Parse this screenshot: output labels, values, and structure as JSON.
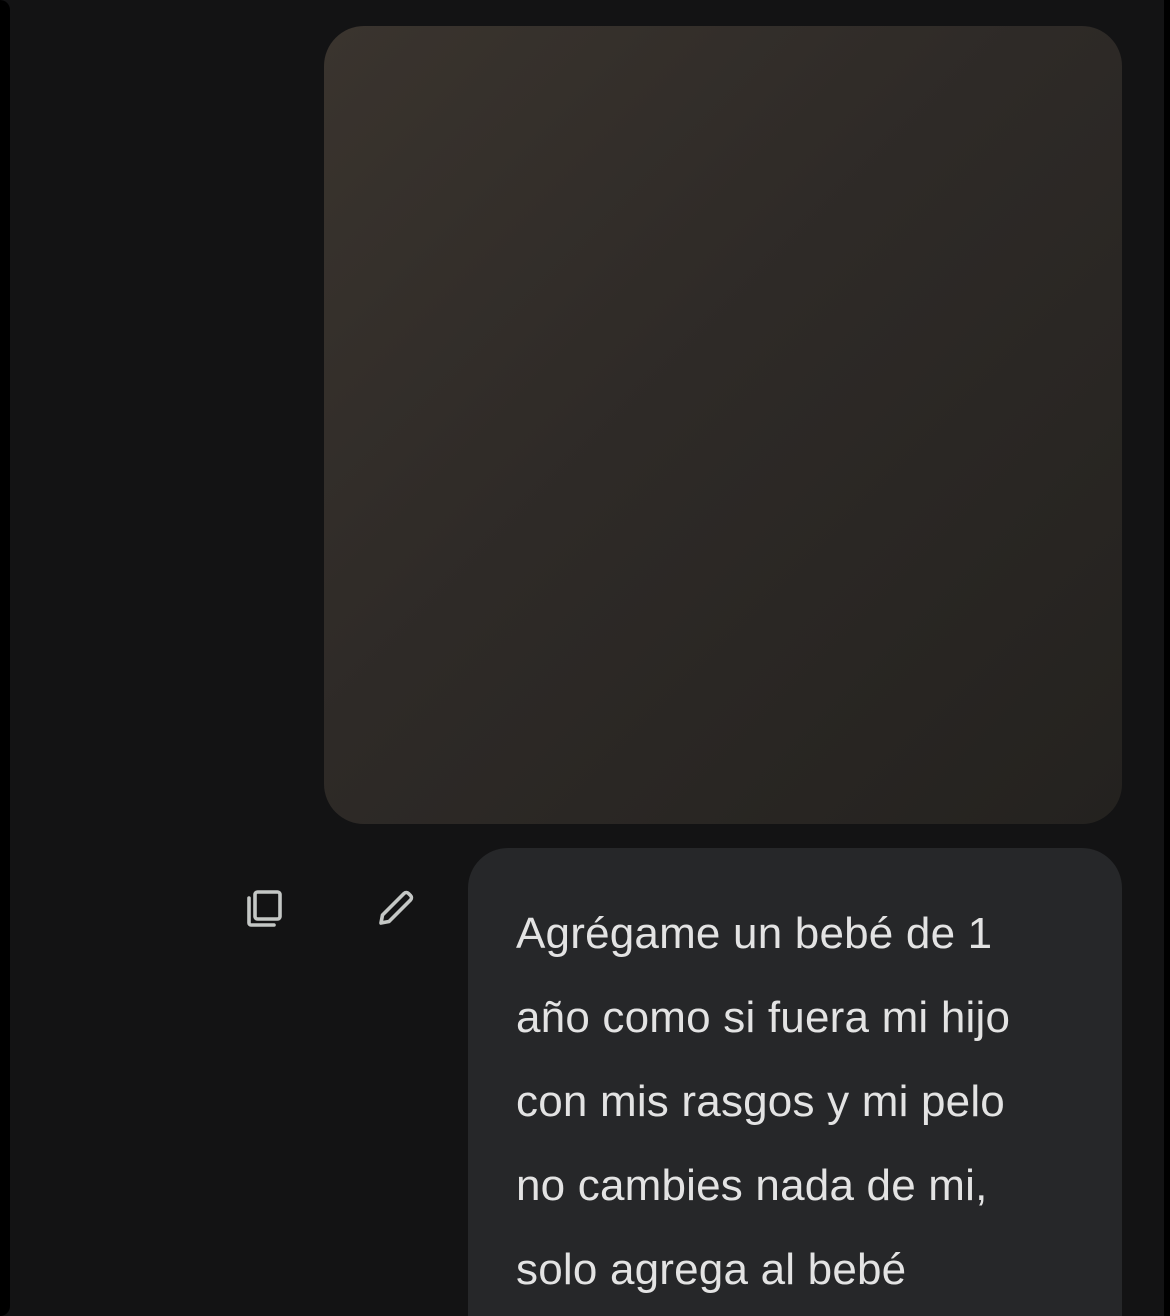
{
  "conversation": {
    "user_image": {
      "alt": "Attached photo",
      "icon": "image-attachment"
    },
    "actions": {
      "copy_icon": "copy-icon",
      "edit_icon": "edit-pencil-icon"
    },
    "user_message": {
      "lines": [
        "Agrégame un bebé de 1",
        "año como si fuera mi hijo",
        "con mis rasgos y mi pelo",
        "no cambies nada de mi,",
        "solo agrega al bebé"
      ]
    }
  },
  "colors": {
    "background": "#131314",
    "bubble": "#262729",
    "text": "#e3e3e3",
    "icon": "#c4c7c5"
  }
}
